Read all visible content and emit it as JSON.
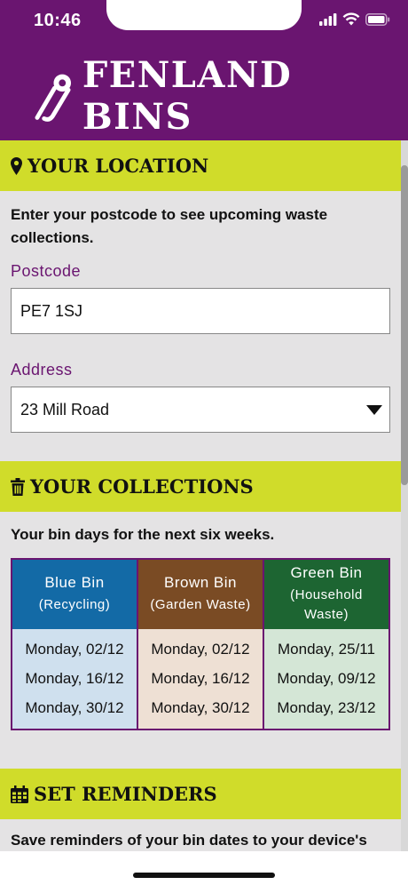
{
  "status": {
    "time": "10:46"
  },
  "app": {
    "title": "FENLAND BINS"
  },
  "location": {
    "heading": "YOUR LOCATION",
    "intro": "Enter your postcode to see upcoming waste collections.",
    "postcode_label": "Postcode",
    "postcode_value": "PE7 1SJ",
    "address_label": "Address",
    "address_value": "23 Mill Road"
  },
  "collections": {
    "heading": "YOUR COLLECTIONS",
    "intro": "Your bin days for the next six weeks.",
    "bins": [
      {
        "name": "Blue Bin",
        "sub": "(Recycling)",
        "dates": [
          "Monday, 02/12",
          "Monday, 16/12",
          "Monday, 30/12"
        ],
        "color": "#136aa6"
      },
      {
        "name": "Brown Bin",
        "sub": "(Garden Waste)",
        "dates": [
          "Monday, 02/12",
          "Monday, 16/12",
          "Monday, 30/12"
        ],
        "color": "#7a4b24"
      },
      {
        "name": "Green Bin",
        "sub": "(Household Waste)",
        "dates": [
          "Monday, 25/11",
          "Monday, 09/12",
          "Monday, 23/12"
        ],
        "color": "#1d6532"
      }
    ]
  },
  "reminders": {
    "heading": "SET REMINDERS",
    "intro": "Save reminders of your bin dates to your device's"
  },
  "colors": {
    "brand": "#6a1570",
    "accent": "#d0dc2a"
  },
  "icons": [
    "pin-icon",
    "trash-icon",
    "calendar-icon",
    "caret-down-icon",
    "safety-pin-logo-icon",
    "signal-icon",
    "wifi-icon",
    "battery-icon"
  ]
}
